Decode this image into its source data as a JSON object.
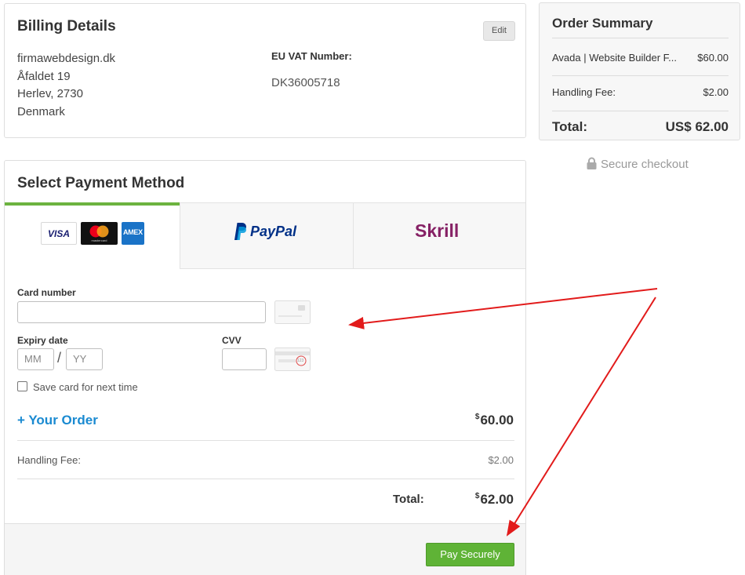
{
  "billing": {
    "title": "Billing Details",
    "edit_label": "Edit",
    "address": [
      "firmawebdesign.dk",
      "Åfaldet 19",
      "Herlev, 2730",
      "Denmark"
    ],
    "vat_label": "EU VAT Number:",
    "vat_value": "DK36005718"
  },
  "summary": {
    "title": "Order Summary",
    "item_name": "Avada | Website Builder F...",
    "item_price": "$60.00",
    "fee_label": "Handling Fee:",
    "fee_value": "$2.00",
    "total_label": "Total:",
    "total_value": "US$ 62.00"
  },
  "secure_checkout": "Secure checkout",
  "payment": {
    "title": "Select Payment Method",
    "tabs": [
      {
        "name": "cards",
        "logos": [
          "VISA",
          "mastercard",
          "AMEX"
        ]
      },
      {
        "name": "paypal",
        "text": "PayPal"
      },
      {
        "name": "skrill",
        "text": "Skrill"
      }
    ],
    "active_tab": "cards",
    "card_number_label": "Card number",
    "expiry_label": "Expiry date",
    "mm_placeholder": "MM",
    "slash": "/",
    "yy_placeholder": "YY",
    "cvv_label": "CVV",
    "cvv_hint": "123",
    "save_card_label": "Save card for next time",
    "save_card_checked": false,
    "your_order_label": "+ Your Order",
    "order_currency": "$",
    "order_amount": "60.00",
    "fee_label": "Handling Fee:",
    "fee_value": "$2.00",
    "total_label": "Total:",
    "total_currency": "$",
    "total_amount": "62.00",
    "pay_button": "Pay Securely"
  },
  "colors": {
    "accent_green": "#6cb33f",
    "link_blue": "#1a8ad1",
    "button_green": "#5fb336",
    "annotation_red": "#e21b1b",
    "paypal_dark": "#003087",
    "paypal_light": "#009cde",
    "skrill_purple": "#862165"
  }
}
